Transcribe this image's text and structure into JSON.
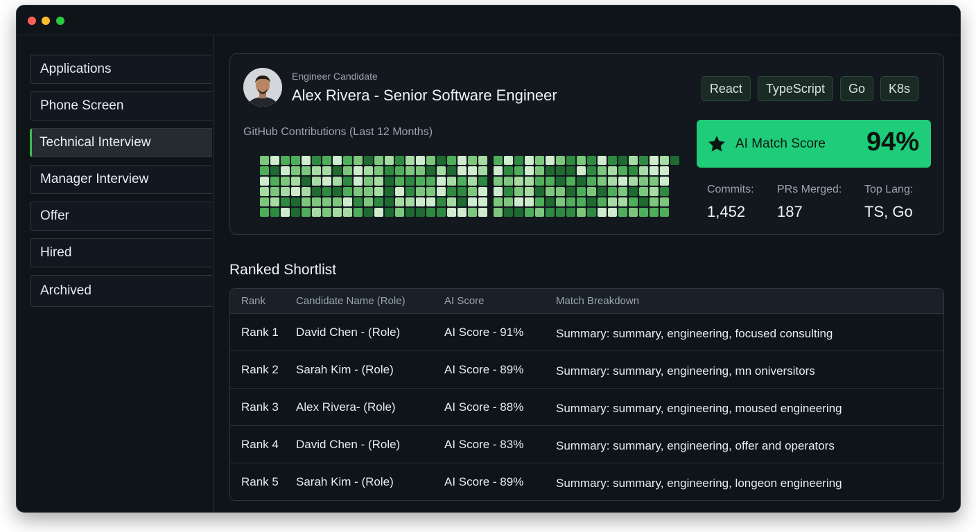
{
  "sidebar": {
    "items": [
      {
        "label": "Applications"
      },
      {
        "label": "Phone Screen"
      },
      {
        "label": "Technical Interview"
      },
      {
        "label": "Manager Interview"
      },
      {
        "label": "Offer"
      },
      {
        "label": "Hired"
      },
      {
        "label": "Archived"
      }
    ],
    "active_index": 2
  },
  "candidate": {
    "label": "Engineer Candidate",
    "name": "Alex Rivera - Senior Software Engineer",
    "tags": [
      "React",
      "TypeScript",
      "Go",
      "K8s"
    ]
  },
  "github": {
    "label": "GitHub Contributions (Last 12 Months)"
  },
  "match": {
    "label": "AI Match Score",
    "value": "94%"
  },
  "stats": [
    {
      "label": "Commits:",
      "value": "1,452"
    },
    {
      "label": "PRs Merged:",
      "value": "187"
    },
    {
      "label": "Top Lang:",
      "value": "TS, Go"
    }
  ],
  "shortlist": {
    "title": "Ranked Shortlist",
    "columns": [
      "Rank",
      "Candidate Name (Role)",
      "AI Score",
      "Match Breakdown"
    ],
    "rows": [
      {
        "rank": "Rank 1",
        "name": "David Chen - (Role)",
        "score": "AI Score - 91%",
        "breakdown": "Summary: summary, engineering, focused consulting"
      },
      {
        "rank": "Rank 2",
        "name": "Sarah Kim - (Role)",
        "score": "AI Score - 89%",
        "breakdown": "Summary: summary, engineering, mn oniversitors"
      },
      {
        "rank": "Rank 3",
        "name": "Alex Rivera- (Role)",
        "score": "AI Score - 88%",
        "breakdown": "Summary: summary, engineering, moused engineering"
      },
      {
        "rank": "Rank 4",
        "name": "David Chen - (Role)",
        "score": "AI Score - 83%",
        "breakdown": "Summary: summary, engineering, offer and operators"
      },
      {
        "rank": "Rank 5",
        "name": "Sarah Kim - (Role)",
        "score": "AI Score - 89%",
        "breakdown": "Summary: summary, engineering, longeon engineering"
      }
    ]
  },
  "colors": {
    "accent": "#1fcc79",
    "background": "#0f1419",
    "heat_levels": [
      "#cfeccf",
      "#a6dba4",
      "#7cc77c",
      "#4fae5a",
      "#2f8a41",
      "#1e6a31"
    ]
  }
}
